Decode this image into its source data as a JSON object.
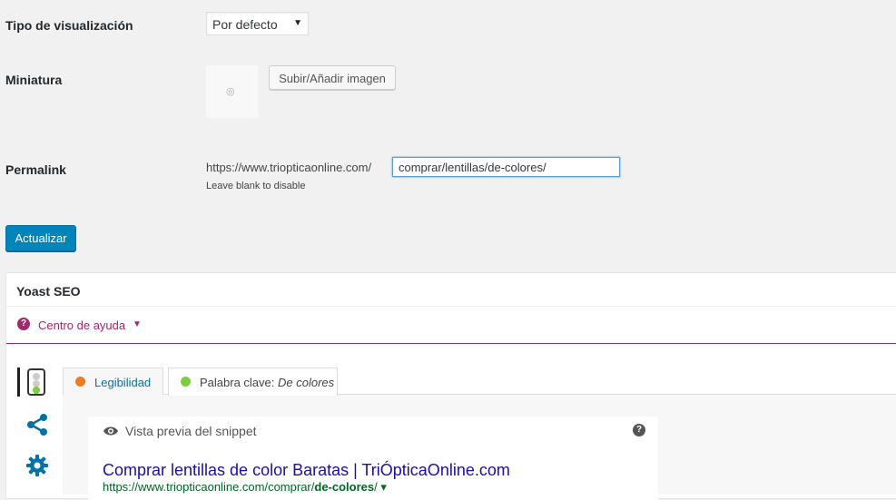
{
  "form": {
    "display_type": {
      "label": "Tipo de visualización",
      "selected": "Por defecto"
    },
    "thumbnail": {
      "label": "Miniatura",
      "upload_button": "Subir/Añadir imagen"
    },
    "permalink": {
      "label": "Permalink",
      "prefix": "https://www.triopticaonline.com/",
      "value": "comprar/lentillas/de-colores/",
      "hint": "Leave blank to disable"
    },
    "update_button": "Actualizar"
  },
  "yoast": {
    "title": "Yoast SEO",
    "help_center": "Centro de ayuda",
    "tabs": [
      {
        "label": "Legibilidad",
        "status_color": "#ee7c1b"
      },
      {
        "label_prefix": "Palabra clave: ",
        "label_keyword": "De colores",
        "status_color": "#7ad03a"
      }
    ],
    "snippet": {
      "heading": "Vista previa del snippet",
      "serp_title": "Comprar lentillas de color Baratas | TriÓpticaOnline.com",
      "serp_url_prefix": "https://www.triopticaonline.com/comprar/",
      "serp_url_bold": "de-colores",
      "serp_url_suffix": "/ ▾"
    }
  },
  "colors": {
    "accent": "#0085ba",
    "yoast_brand": "#a4286a",
    "link": "#1a0dab",
    "url_green": "#006621",
    "icon_blue": "#0073aa"
  }
}
